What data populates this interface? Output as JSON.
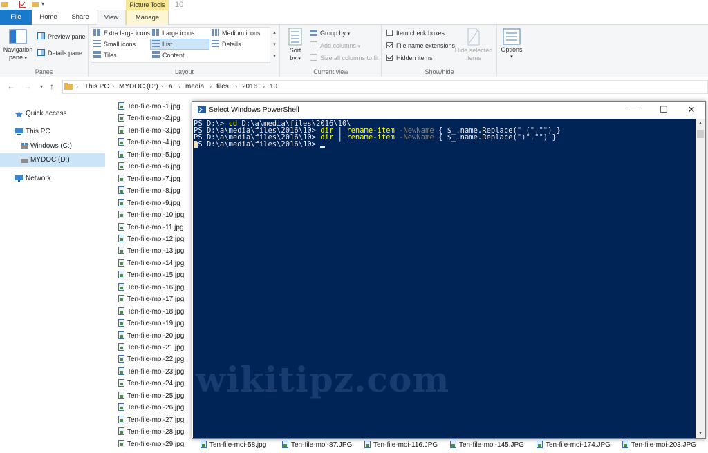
{
  "window": {
    "title": "10",
    "picture_tools": "Picture Tools"
  },
  "tabs": {
    "file": "File",
    "home": "Home",
    "share": "Share",
    "view": "View",
    "manage": "Manage"
  },
  "ribbon": {
    "panes": {
      "navigation_pane": "Navigation",
      "navigation_pane_2": "pane",
      "preview_pane": "Preview pane",
      "details_pane": "Details pane",
      "label": "Panes"
    },
    "layout": {
      "extra_large": "Extra large icons",
      "large": "Large icons",
      "medium": "Medium icons",
      "small": "Small icons",
      "list": "List",
      "details": "Details",
      "tiles": "Tiles",
      "content": "Content",
      "label": "Layout"
    },
    "current_view": {
      "sort_by": "Sort",
      "sort_by_2": "by",
      "group_by": "Group by",
      "add_columns": "Add columns",
      "size_columns": "Size all columns to fit",
      "label": "Current view"
    },
    "show_hide": {
      "item_check_boxes": "Item check boxes",
      "file_name_extensions": "File name extensions",
      "hidden_items": "Hidden items",
      "hide_selected": "Hide selected",
      "hide_selected_2": "items",
      "label": "Show/hide",
      "checks": {
        "item_check_boxes": false,
        "file_name_extensions": true,
        "hidden_items": true
      }
    },
    "options": "Options"
  },
  "address": {
    "crumbs": [
      "This PC",
      "MYDOC (D:)",
      "a",
      "media",
      "files",
      "2016",
      "10"
    ]
  },
  "nav": {
    "quick_access": "Quick access",
    "this_pc": "This PC",
    "windows_c": "Windows (C:)",
    "mydoc_d": "MYDOC (D:)",
    "network": "Network"
  },
  "files": {
    "col1": [
      "Ten-file-moi-1.jpg",
      "Ten-file-moi-2.jpg",
      "Ten-file-moi-3.jpg",
      "Ten-file-moi-4.jpg",
      "Ten-file-moi-5.jpg",
      "Ten-file-moi-6.jpg",
      "Ten-file-moi-7.jpg",
      "Ten-file-moi-8.jpg",
      "Ten-file-moi-9.jpg",
      "Ten-file-moi-10.jpg",
      "Ten-file-moi-11.jpg",
      "Ten-file-moi-12.jpg",
      "Ten-file-moi-13.jpg",
      "Ten-file-moi-14.jpg",
      "Ten-file-moi-15.jpg",
      "Ten-file-moi-16.jpg",
      "Ten-file-moi-17.jpg",
      "Ten-file-moi-18.jpg",
      "Ten-file-moi-19.jpg",
      "Ten-file-moi-20.jpg",
      "Ten-file-moi-21.jpg",
      "Ten-file-moi-22.jpg",
      "Ten-file-moi-23.jpg",
      "Ten-file-moi-24.jpg",
      "Ten-file-moi-25.jpg",
      "Ten-file-moi-26.jpg",
      "Ten-file-moi-27.jpg",
      "Ten-file-moi-28.jpg",
      "Ten-file-moi-29.jpg"
    ],
    "bottom": [
      "Ten-file-moi-58.jpg",
      "Ten-file-moi-87.JPG",
      "Ten-file-moi-116.JPG",
      "Ten-file-moi-145.JPG",
      "Ten-file-moi-174.JPG",
      "Ten-file-moi-203.JPG"
    ]
  },
  "powershell": {
    "title": "Select Windows PowerShell",
    "line1": {
      "prompt": "PS D:\\> ",
      "cmd": "cd",
      "arg": " D:\\a\\media\\files\\2016\\10\\"
    },
    "line2": {
      "prompt": "PS D:\\a\\media\\files\\2016\\10> ",
      "cmd1": "dir",
      "pipe": " | ",
      "cmd2": "rename-item",
      "param": " -NewName",
      "rest": " { $_.name.Replace(",
      "a1": "\" (\"",
      "comma": ",",
      "a2": "\"\"",
      "end": ") }"
    },
    "line3": {
      "prompt": "PS D:\\a\\media\\files\\2016\\10> ",
      "cmd1": "dir",
      "pipe": " | ",
      "cmd2": "rename-item",
      "param": " -NewName",
      "rest": " { $_.name.Replace(",
      "a1": "\")\"",
      "comma": ",",
      "a2": "\"\"",
      "end": ") }"
    },
    "line4": {
      "prompt": "PS D:\\a\\media\\files\\2016\\10> "
    }
  },
  "watermark": "wikitipz.com"
}
